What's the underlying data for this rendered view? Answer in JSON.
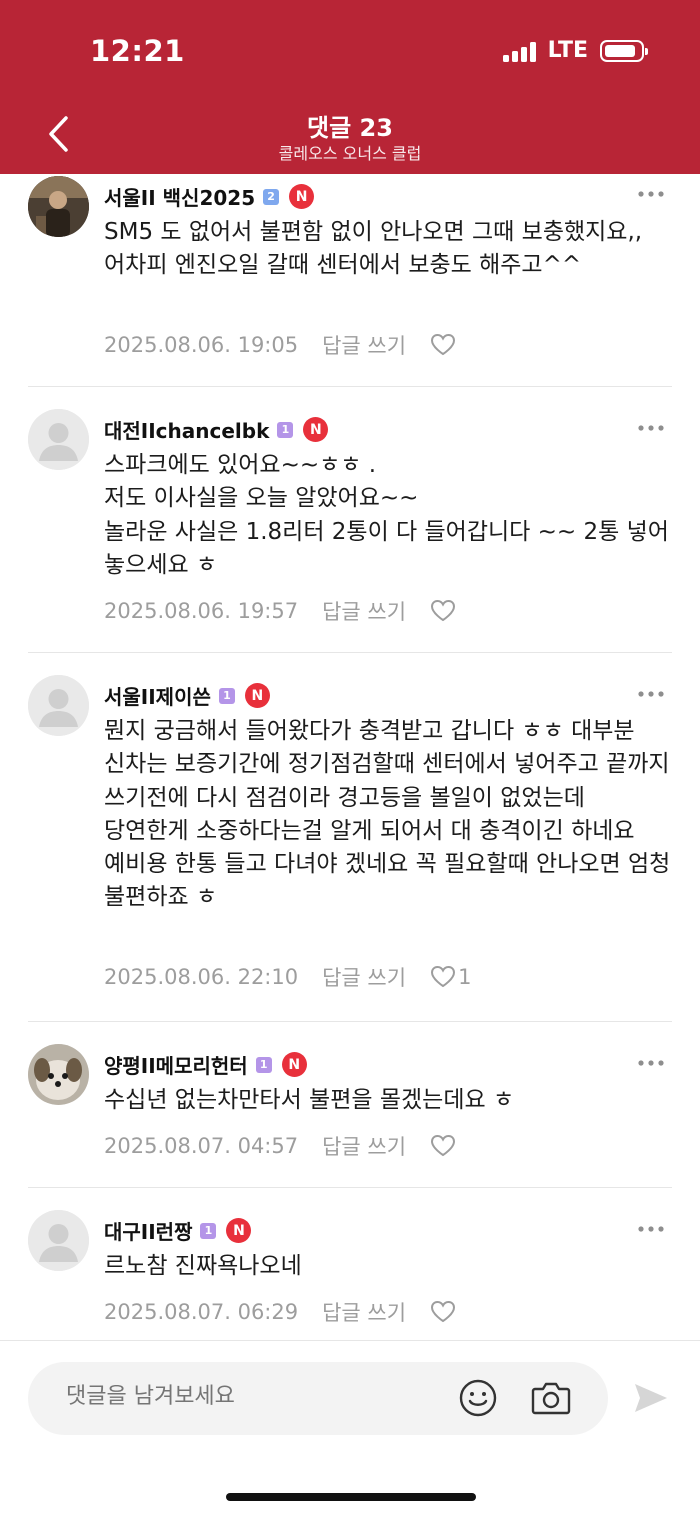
{
  "status_bar": {
    "time": "12:21",
    "network": "LTE"
  },
  "nav": {
    "title": "댓글 23",
    "subtitle": "콜레오스 오너스 클럽"
  },
  "comments": [
    {
      "author": "서울II 백신2025",
      "level": "2",
      "badge": "N",
      "text": "SM5 도 없어서 불편함 없이 안나오면 그때 보충했지요,,어차피 엔진오일 갈때 센터에서 보충도 해주고^^",
      "date": "2025.08.06. 19:05",
      "reply_label": "답글 쓰기",
      "likes": ""
    },
    {
      "author": "대전IIchancelbk",
      "level": "1",
      "badge": "N",
      "text": "스파크에도 있어요~~ㅎㅎ .\n저도 이사실을 오늘 알았어요~~\n놀라운 사실은 1.8리터 2통이 다 들어갑니다 ~~  2통 넣어 놓으세요 ㅎ",
      "date": "2025.08.06. 19:57",
      "reply_label": "답글 쓰기",
      "likes": ""
    },
    {
      "author": "서울II제이쓴",
      "level": "1",
      "badge": "N",
      "text": "뭔지 궁금해서 들어왔다가 충격받고 갑니다 ㅎㅎ 대부분 신차는 보증기간에 정기점검할때 센터에서 넣어주고 끝까지 쓰기전에 다시 점검이라 경고등을 볼일이 없었는데 당연한게 소중하다는걸 알게 되어서 대 충격이긴 하네요\n예비용 한통 들고 다녀야 겠네요 꼭 필요할때 안나오면 엄청 불편하죠 ㅎ",
      "date": "2025.08.06. 22:10",
      "reply_label": "답글 쓰기",
      "likes": "1"
    },
    {
      "author": "양평II메모리헌터",
      "level": "1",
      "badge": "N",
      "text": "수십년 없는차만타서 불편을 몰겠는데요 ㅎ",
      "date": "2025.08.07. 04:57",
      "reply_label": "답글 쓰기",
      "likes": ""
    },
    {
      "author": "대구II런짱",
      "level": "1",
      "badge": "N",
      "text": "르노참 진짜욕나오네",
      "date": "2025.08.07. 06:29",
      "reply_label": "답글 쓰기",
      "likes": ""
    }
  ],
  "composer": {
    "placeholder": "댓글을 남겨보세요"
  },
  "colors": {
    "header_bg": "#b82536",
    "badge_red": "#e8303b",
    "level_blue": "#7fa8ee",
    "level_purple": "#b495e8",
    "meta_gray": "#9d9d9d"
  },
  "icons": [
    "back-icon",
    "more-icon",
    "heart-icon",
    "emoji-icon",
    "camera-icon",
    "send-icon",
    "battery-icon",
    "signal-icon"
  ]
}
